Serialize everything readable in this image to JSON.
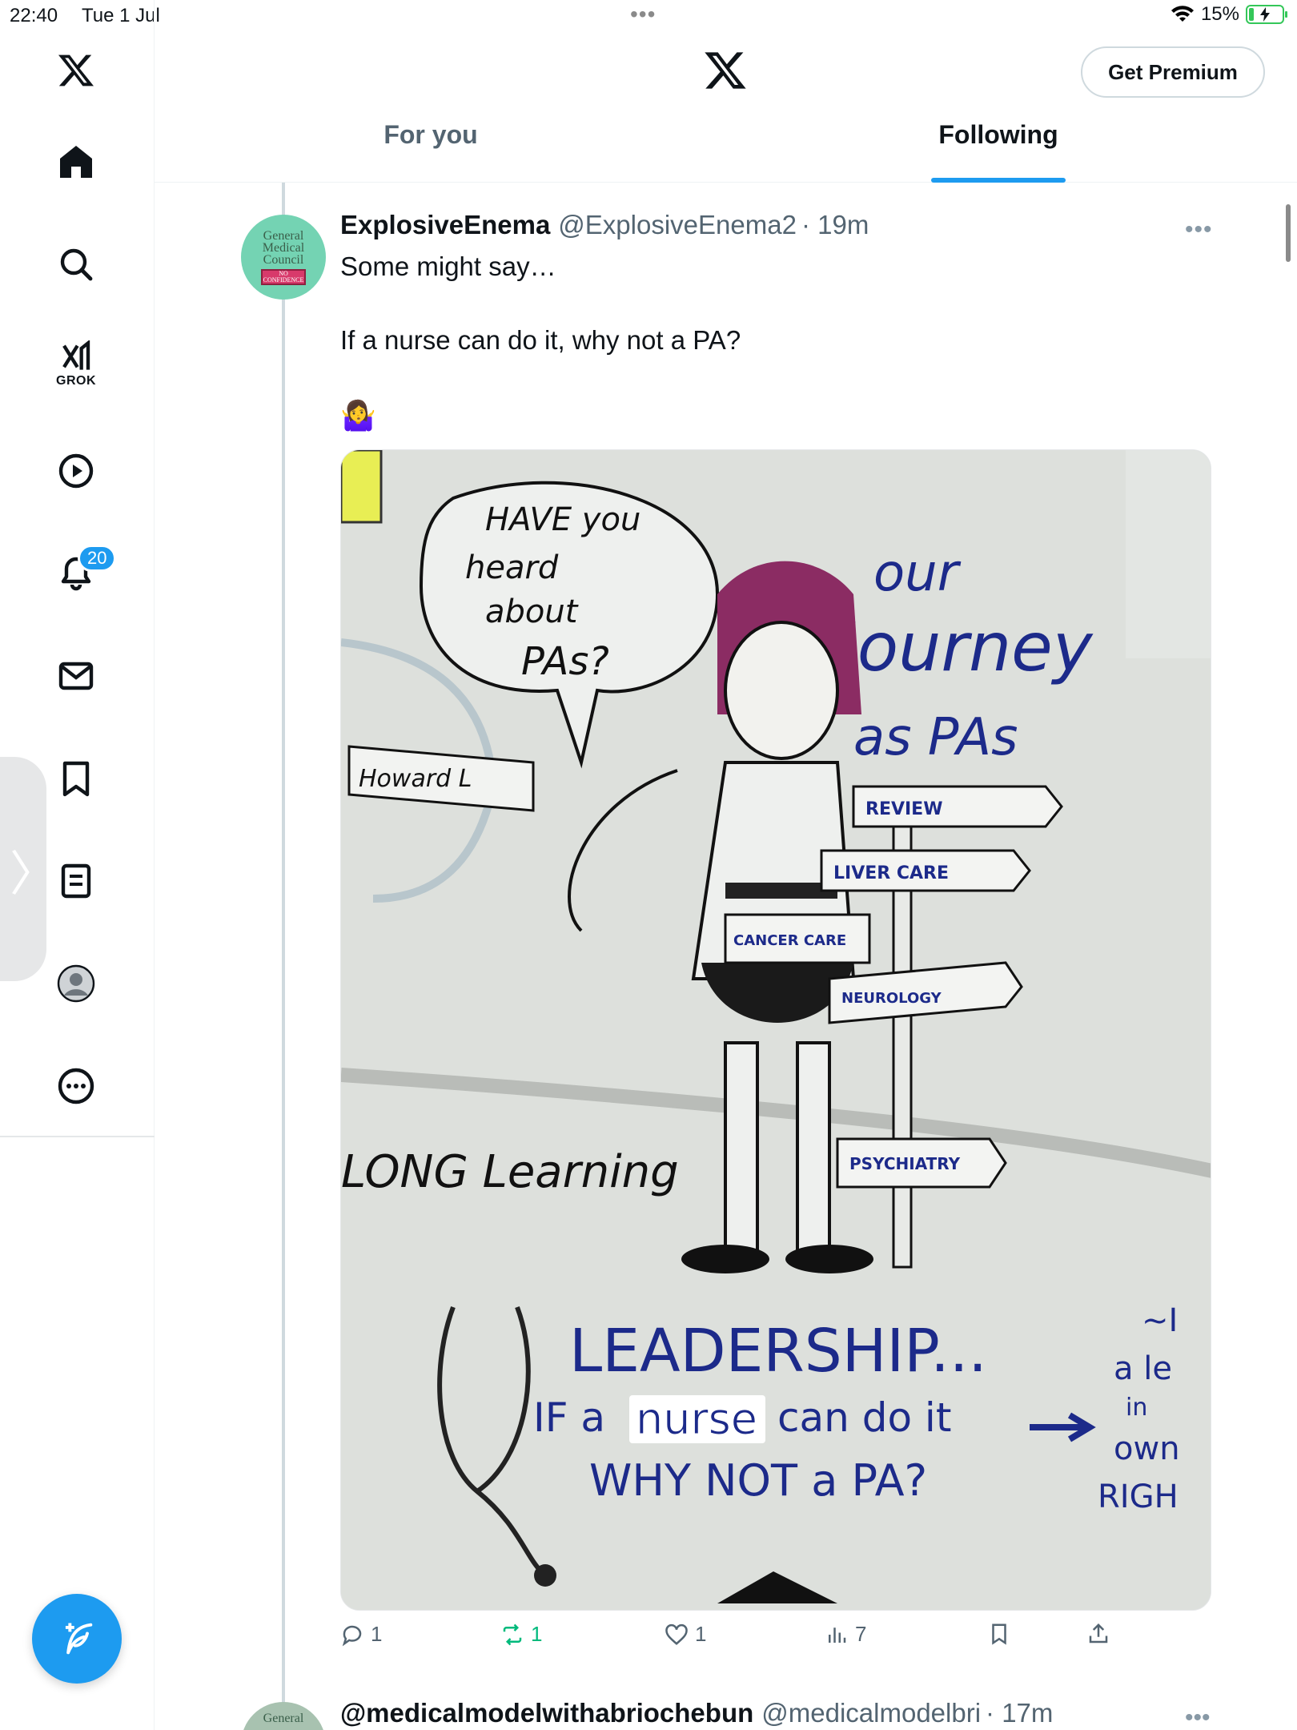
{
  "status_bar": {
    "time": "22:40",
    "date": "Tue 1 Jul",
    "battery": "15%"
  },
  "nav": {
    "grok_label": "GROK",
    "notifications_count": "20",
    "icons": [
      "x-logo-icon",
      "home-icon",
      "search-icon",
      "grok-icon",
      "video-icon",
      "bell-icon",
      "mail-icon",
      "bookmark-icon",
      "lists-icon",
      "profile-icon",
      "more-icon"
    ]
  },
  "header": {
    "get_premium": "Get Premium",
    "tabs": [
      {
        "label": "For you",
        "active": false
      },
      {
        "label": "Following",
        "active": true
      }
    ]
  },
  "post": {
    "display_name": "ExplosiveEnema",
    "handle": "@ExplosiveEnema2",
    "time": "· 19m",
    "text_line1": "Some might say…",
    "text_line2": "If a nurse can do it, why not a PA?",
    "emoji": "🤷‍♀️",
    "avatar_text": "General Medical Council",
    "avatar_badge": "NO CONFIDENCE",
    "image": {
      "bubble_1": "HAVE you",
      "bubble_2": "heard",
      "bubble_3": "about",
      "bubble_4": "PAs?",
      "title_1": "our",
      "title_2": "Journey",
      "title_3": "as PAs",
      "banner": "Howard L",
      "sign_1": "REVIEW",
      "sign_2": "LIVER CARE",
      "sign_3": "CANCER CARE",
      "sign_4": "NEUROLOGY",
      "sign_5": "PSYCHIATRY",
      "long_learning": "LONG Learning",
      "leadership": "LEADERSHIP...",
      "nurse_line_a": "IF a",
      "nurse_word": "nurse",
      "nurse_line_b": "can do it",
      "why_not": "WHY NOT a PA?",
      "right_1": "~I",
      "right_2": "a le",
      "right_3": "in",
      "right_4": "own",
      "right_5": "RIGH"
    },
    "replies": "1",
    "reposts": "1",
    "likes": "1",
    "views": "7"
  },
  "post2": {
    "display_name": "@medicalmodelwithabriochebun",
    "handle": "@medicalmodelbri",
    "time": "· 17m",
    "avatar_text": "General"
  },
  "colors": {
    "accent": "#1d9bf0",
    "retweet": "#00ba7c",
    "text_secondary": "#536471"
  }
}
